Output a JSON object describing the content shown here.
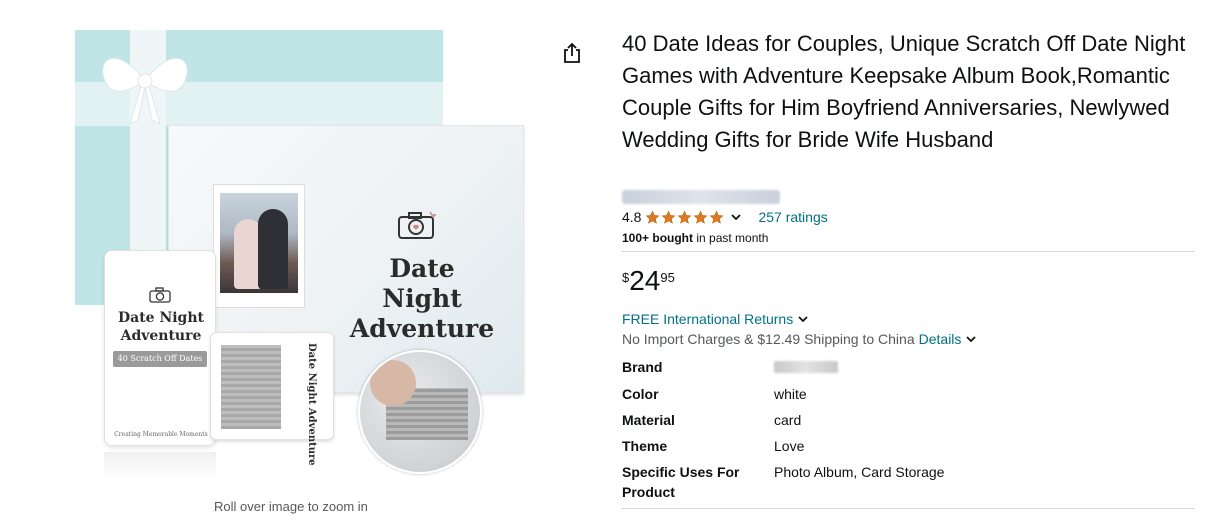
{
  "product": {
    "title": "40 Date Ideas for Couples, Unique Scratch Off Date Night Games with Adventure Keepsake Album Book,Romantic Couple Gifts for Him Boyfriend Anniversaries, Newlywed Wedding Gifts for Bride Wife Husband",
    "rating": "4.8",
    "stars": 5,
    "ratings_count": "257 ratings",
    "bought_bold": "100+ bought",
    "bought_rest": " in past month"
  },
  "price": {
    "symbol": "$",
    "whole": "24",
    "fraction": "95"
  },
  "delivery": {
    "returns": "FREE International Returns",
    "shipping": "No Import Charges & $12.49 Shipping to China",
    "details_link": "Details"
  },
  "specs": [
    {
      "key": "Brand",
      "value": ""
    },
    {
      "key": "Color",
      "value": "white"
    },
    {
      "key": "Material",
      "value": "card"
    },
    {
      "key": "Theme",
      "value": "Love"
    },
    {
      "key": "Specific Uses For Product",
      "value": "Photo Album, Card Storage"
    }
  ],
  "image": {
    "album_title": "Date Night Adventure",
    "card_title": "Date Night Adventure",
    "card_pill": "40 Scratch Off Dates",
    "card_footer": "Creating Memorable Moments",
    "card_back_title": "Date Night Adventure",
    "zoom_hint": "Roll over image to zoom in"
  },
  "colors": {
    "link": "#007185",
    "star": "#de7921",
    "text": "#0f1111",
    "box_teal": "#bfe5e6"
  },
  "icons": {
    "share": "share-icon",
    "chevron": "chevron-down-icon",
    "star": "star-icon",
    "camera": "camera-icon"
  }
}
